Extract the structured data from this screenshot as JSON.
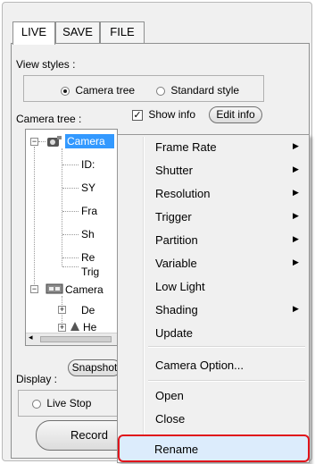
{
  "tabs": [
    "LIVE",
    "SAVE",
    "FILE"
  ],
  "view_styles": {
    "label": "View styles :",
    "options": [
      {
        "label": "Camera tree",
        "selected": true
      },
      {
        "label": "Standard style",
        "selected": false
      }
    ]
  },
  "camera_tree": {
    "label": "Camera tree :",
    "show_info": {
      "label": "Show info",
      "checked": true
    },
    "edit_info_button": "Edit info",
    "nodes": {
      "camera1": "Camera",
      "id": "ID:",
      "sy": "SY",
      "fra": "Fra",
      "sh": "Sh",
      "re": "Re",
      "tri": "Trig",
      "camera2": "Camera",
      "de": "De",
      "he": "He"
    }
  },
  "snapshot_button": "Snapshot",
  "display": {
    "label": "Display :",
    "live_stop": "Live Stop"
  },
  "record_button": "Record",
  "context_menu": {
    "items": [
      {
        "label": "Frame Rate",
        "submenu": true
      },
      {
        "label": "Shutter",
        "submenu": true
      },
      {
        "label": "Resolution",
        "submenu": true
      },
      {
        "label": "Trigger",
        "submenu": true
      },
      {
        "label": "Partition",
        "submenu": true
      },
      {
        "label": "Variable",
        "submenu": true
      },
      {
        "label": "Low Light",
        "submenu": false
      },
      {
        "label": "Shading",
        "submenu": true
      },
      {
        "label": "Update",
        "submenu": false
      },
      {
        "label": "Camera Option...",
        "submenu": false
      },
      {
        "label": "Open",
        "submenu": false
      },
      {
        "label": "Close",
        "submenu": false
      },
      {
        "label": "Rename",
        "submenu": false
      }
    ],
    "highlighted": "Rename"
  },
  "colors": {
    "highlight_border": "#e0141b",
    "selection": "#3399ff"
  },
  "icons": [
    "camera-icon",
    "camera-box-icon",
    "device-icon",
    "expand-icon",
    "collapse-icon",
    "submenu-arrow-icon"
  ]
}
